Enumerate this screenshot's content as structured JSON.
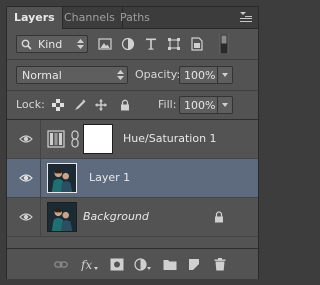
{
  "tabs": [
    {
      "label": "Layers",
      "active": true
    },
    {
      "label": "Channels",
      "active": false
    },
    {
      "label": "Paths",
      "active": false
    }
  ],
  "filter": {
    "kind_label": "Kind",
    "icons": [
      "image-filter-icon",
      "adjustment-filter-icon",
      "type-filter-icon",
      "shape-filter-icon",
      "smart-object-filter-icon",
      "filter-toggle-icon"
    ]
  },
  "blend": {
    "mode": "Normal",
    "opacity_label": "Opacity:",
    "opacity_value": "100%"
  },
  "lock": {
    "label": "Lock:",
    "fill_label": "Fill:",
    "fill_value": "100%"
  },
  "layers": [
    {
      "name": "Hue/Saturation 1",
      "type": "adjustment",
      "visible": true,
      "selected": false,
      "italic": false
    },
    {
      "name": "Layer 1",
      "type": "image",
      "visible": true,
      "selected": true,
      "italic": false
    },
    {
      "name": "Background",
      "type": "image",
      "visible": true,
      "selected": false,
      "italic": true,
      "locked": true
    }
  ],
  "footer_icons": [
    "link-icon",
    "fx-icon",
    "mask-icon",
    "adjustment-icon",
    "folder-icon",
    "new-layer-icon",
    "trash-icon"
  ],
  "colors": {
    "panel": "#535353",
    "selected": "#5e6b7f",
    "tabbar": "#3c3c3c"
  }
}
